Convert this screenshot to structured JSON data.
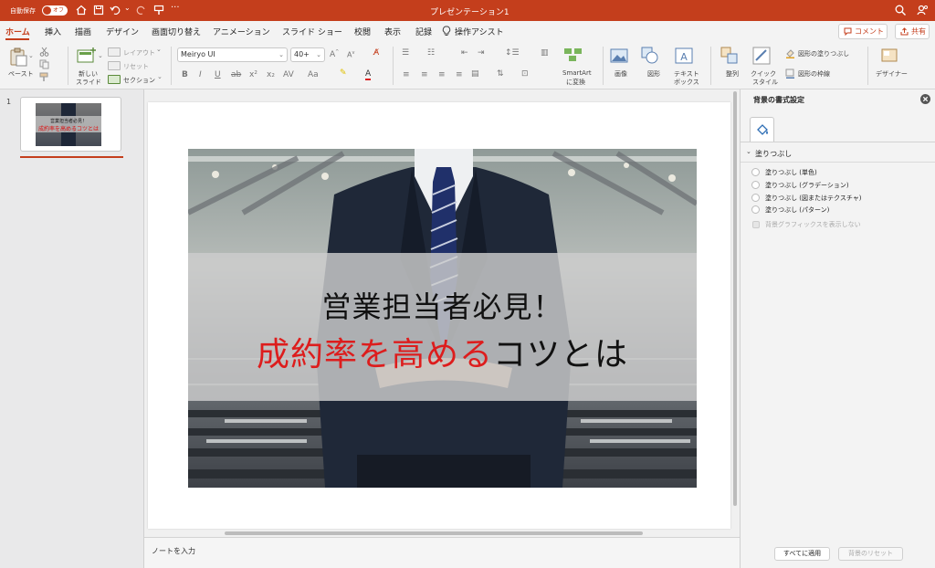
{
  "window": {
    "title": "プレゼンテーション1",
    "autosave_label": "自動保存",
    "autosave_state": "オフ",
    "accent_color": "#c43e1c"
  },
  "tabs": [
    "ホーム",
    "挿入",
    "描画",
    "デザイン",
    "画面切り替え",
    "アニメーション",
    "スライド ショー",
    "校閲",
    "表示",
    "記録"
  ],
  "tell_me": "操作アシスト",
  "comment_button": "コメント",
  "share_button": "共有",
  "ribbon": {
    "paste": "ペースト",
    "new_slide": [
      "新しい",
      "スライド"
    ],
    "layout": "レイアウト",
    "reset": "リセット",
    "section": "セクション",
    "font_name": "Meiryo UI",
    "font_size": "40+",
    "smartart": [
      "SmartArt",
      "に変換"
    ],
    "image": "画像",
    "shape": "図形",
    "textbox": [
      "テキスト",
      "ボックス"
    ],
    "arrange": "整列",
    "quick_style": [
      "クイック",
      "スタイル"
    ],
    "shape_fill": "図形の塗りつぶし",
    "shape_outline": "図形の枠線",
    "designer": "デザイナー"
  },
  "thumbnail": {
    "number": "1",
    "line1": "営業担当者必見！",
    "line2": "成約率を高めるコツとは"
  },
  "slide": {
    "title_line1": "営業担当者必見！",
    "title_line2_red": "成約率を高める",
    "title_line2_black": "コツとは"
  },
  "notes_placeholder": "ノートを入力",
  "format_pane": {
    "title": "背景の書式設定",
    "section": "塗りつぶし",
    "options": [
      "塗りつぶし (単色)",
      "塗りつぶし (グラデーション)",
      "塗りつぶし (図またはテクスチャ)",
      "塗りつぶし (パターン)"
    ],
    "hide_graphics": "背景グラフィックスを表示しない",
    "apply_all": "すべてに適用",
    "reset_bg": "背景のリセット"
  }
}
